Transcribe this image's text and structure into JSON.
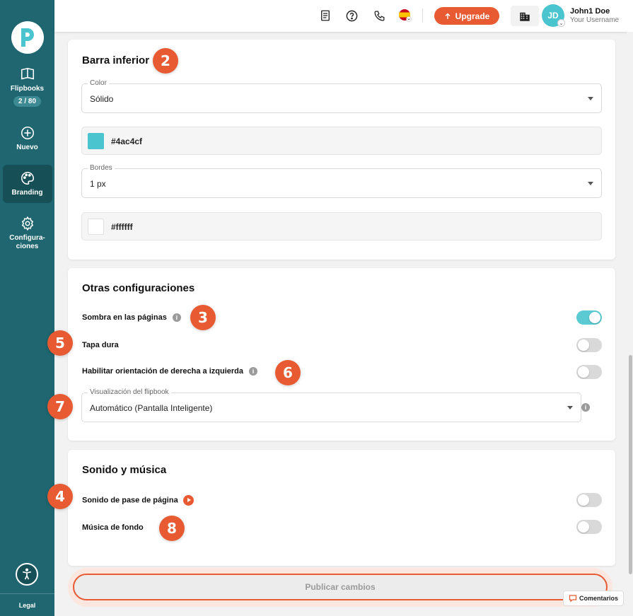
{
  "sidebar": {
    "flipbooks_label": "Flipbooks",
    "flipbooks_count": "2 / 80",
    "new_label": "Nuevo",
    "branding_label": "Branding",
    "config_label_1": "Configura-",
    "config_label_2": "ciones",
    "legal_label": "Legal"
  },
  "header": {
    "upgrade_label": "Upgrade",
    "avatar_initials": "JD",
    "user_name": "John1 Doe",
    "user_sub": "Your Username"
  },
  "bottom_bar": {
    "title": "Barra inferior",
    "color_label": "Color",
    "color_value": "Sólido",
    "color_hex": "#4ac4cf",
    "borders_label": "Bordes",
    "borders_value": "1 px",
    "border_hex": "#ffffff"
  },
  "other_settings": {
    "title": "Otras configuraciones",
    "page_shadow_label": "Sombra en las páginas",
    "page_shadow_on": true,
    "hard_cover_label": "Tapa dura",
    "hard_cover_on": false,
    "rtl_label": "Habilitar orientación de derecha a izquierda",
    "rtl_on": false,
    "view_label": "Visualización del flipbook",
    "view_value": "Automático (Pantalla Inteligente)"
  },
  "sound": {
    "title": "Sonido y música",
    "page_sound_label": "Sonido de pase de página",
    "page_sound_on": false,
    "bg_music_label": "Música de fondo",
    "bg_music_on": false
  },
  "badges": {
    "b2": "2",
    "b3": "3",
    "b4": "4",
    "b5": "5",
    "b6": "6",
    "b7": "7",
    "b8": "8"
  },
  "footer": {
    "publish_label": "Publicar cambios",
    "comments_label": "Comentarios"
  },
  "colors": {
    "sidebar": "#1f6670",
    "accent": "#e85a32",
    "teal": "#4ac4cf"
  }
}
